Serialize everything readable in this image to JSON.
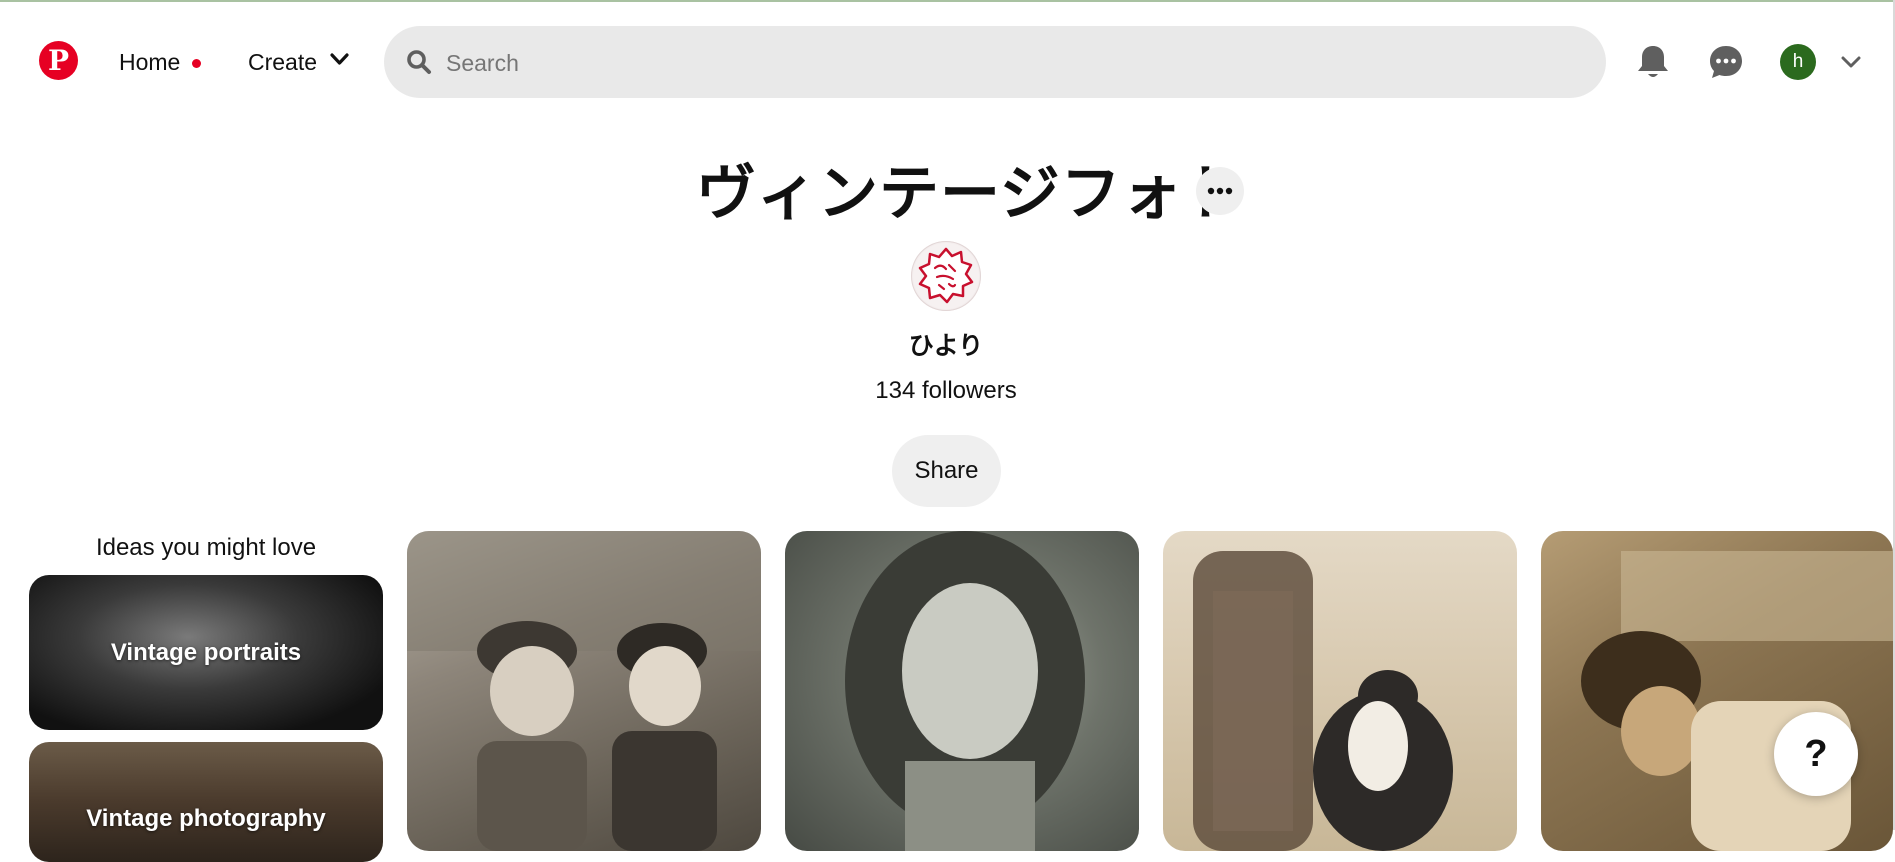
{
  "header": {
    "home_label": "Home",
    "create_label": "Create",
    "search_placeholder": "Search",
    "avatar_letter": "h",
    "accent_color": "#e60023"
  },
  "board": {
    "title": "ヴィンテージフォト",
    "owner_name": "ひより",
    "followers": "134 followers",
    "share_label": "Share",
    "more_icon": "ellipsis-icon"
  },
  "ideas": {
    "heading": "Ideas you might love",
    "cards": [
      {
        "label": "Vintage portraits"
      },
      {
        "label": "Vintage photography"
      }
    ]
  },
  "pins": [
    {
      "subject": "two children in caps"
    },
    {
      "subject": "girl with curly hair"
    },
    {
      "subject": "cat on chair"
    },
    {
      "subject": "boy with kitten"
    }
  ],
  "help": {
    "label": "?"
  }
}
